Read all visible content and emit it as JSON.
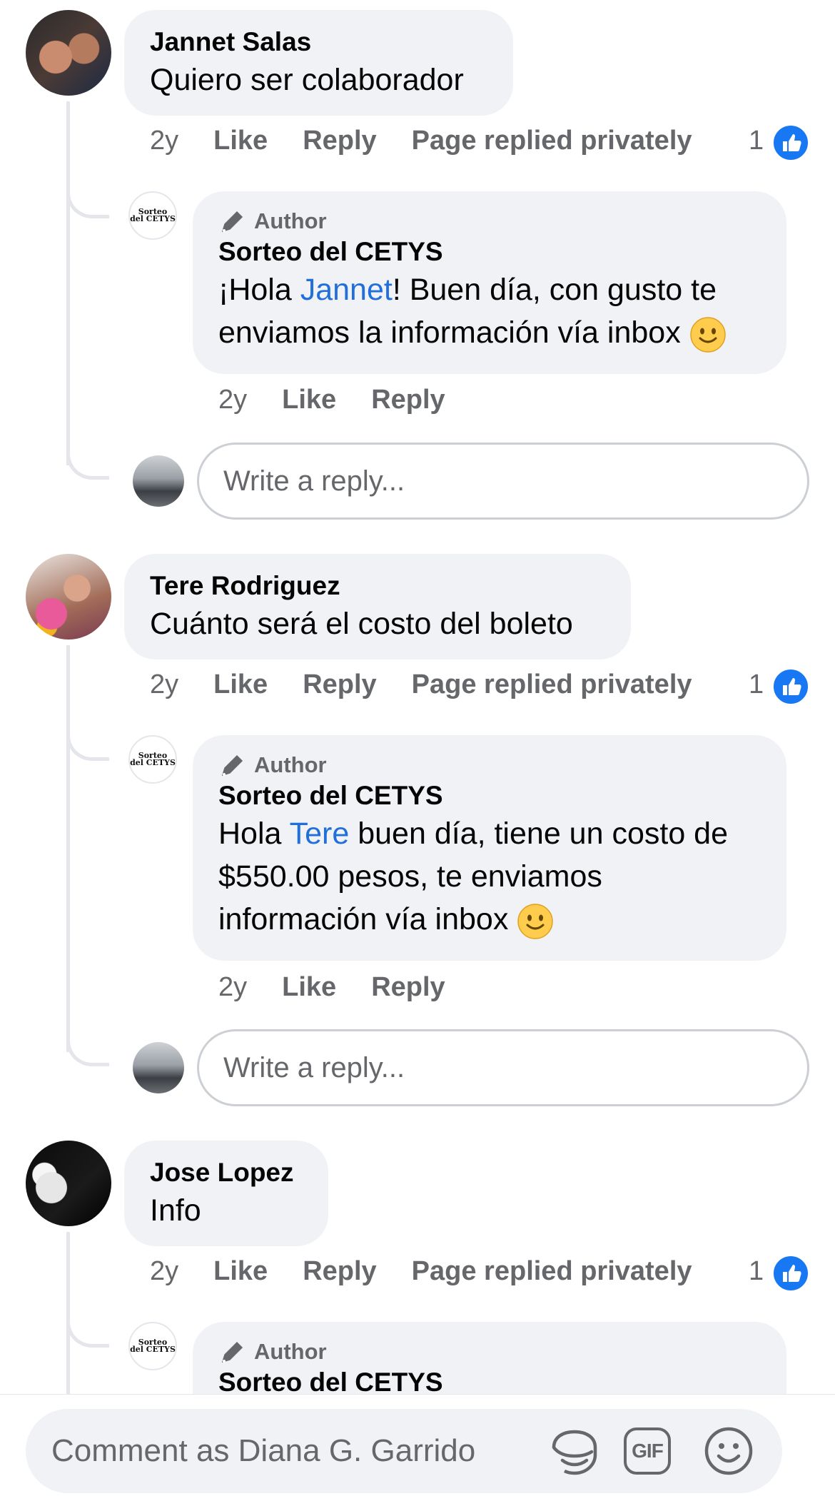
{
  "comments": [
    {
      "author": "Jannet Salas",
      "text": "Quiero ser colaborador",
      "time": "2y",
      "like_label": "Like",
      "reply_label": "Reply",
      "status": "Page replied privately",
      "like_count": "1",
      "reply": {
        "badge": "Author",
        "author": "Sorteo del CETYS",
        "text_pre": "¡Hola ",
        "mention": "Jannet",
        "text_post": "! Buen día, con gusto te enviamos la información vía inbox",
        "time": "2y",
        "like_label": "Like",
        "reply_label": "Reply"
      },
      "reply_placeholder": "Write a reply..."
    },
    {
      "author": "Tere Rodriguez",
      "text": "Cuánto será el costo del boleto",
      "time": "2y",
      "like_label": "Like",
      "reply_label": "Reply",
      "status": "Page replied privately",
      "like_count": "1",
      "reply": {
        "badge": "Author",
        "author": "Sorteo del CETYS",
        "text_pre": "Hola ",
        "mention": "Tere",
        "text_post": " buen día, tiene un costo de $550.00 pesos, te enviamos información vía inbox",
        "time": "2y",
        "like_label": "Like",
        "reply_label": "Reply"
      },
      "reply_placeholder": "Write a reply..."
    },
    {
      "author": "Jose Lopez",
      "text": "Info",
      "time": "2y",
      "like_label": "Like",
      "reply_label": "Reply",
      "status": "Page replied privately",
      "like_count": "1",
      "reply": {
        "badge": "Author",
        "author": "Sorteo del CETYS"
      }
    }
  ],
  "page_logo_text": [
    "Sorteo",
    "del CETYS"
  ],
  "composer": {
    "placeholder": "Comment as Diana G. Garrido",
    "icons": [
      "sticker-icon",
      "gif-icon",
      "emoji-icon"
    ],
    "gif_label": "GIF"
  },
  "colors": {
    "like_blue": "#1877f2",
    "mention_blue": "#216fdb",
    "bubble_gray": "#f0f2f5",
    "meta_gray": "#65676b"
  }
}
